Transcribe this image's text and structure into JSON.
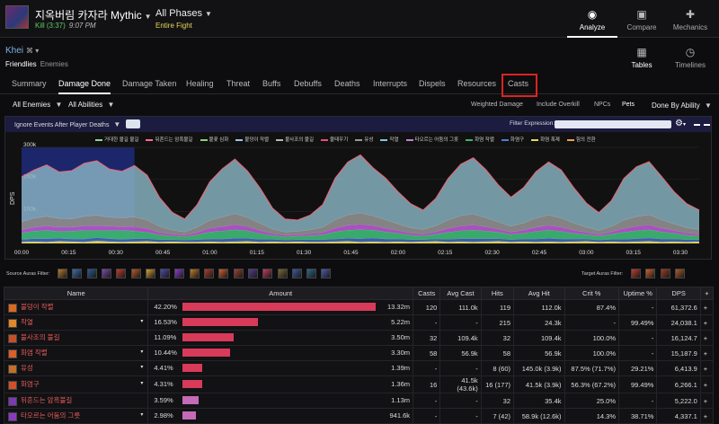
{
  "header": {
    "boss_name": "지옥버림 카자라 Mythic",
    "kill_text": "Kill (3:37)",
    "kill_time": "9:07 PM",
    "phases_label": "All Phases",
    "fight_label": "Entire Fight",
    "nav": [
      {
        "label": "Analyze",
        "icon": "eye-icon"
      },
      {
        "label": "Compare",
        "icon": "compare-icon"
      },
      {
        "label": "Mechanics",
        "icon": "puzzle-icon"
      }
    ]
  },
  "subheader": {
    "player_name": "Khei",
    "player_suffix": "⌘ ▾",
    "friends": "Friendlies",
    "enemies": "Enemies",
    "views": [
      {
        "label": "Tables",
        "icon": "grid-icon"
      },
      {
        "label": "Timelines",
        "icon": "clock-icon"
      }
    ]
  },
  "tabs": [
    "Summary",
    "Damage Done",
    "Damage Taken",
    "Healing",
    "Threat",
    "Buffs",
    "Debuffs",
    "Deaths",
    "Interrupts",
    "Dispels",
    "Resources",
    "Casts"
  ],
  "active_tab": "Damage Done",
  "filters": {
    "enemies": "All Enemies",
    "abilities": "All Abilities",
    "options": [
      "Weighted Damage",
      "Include Overkill",
      "NPCs",
      "Pets"
    ],
    "active_option": "Pets",
    "done_by": "Done By Ability"
  },
  "graph": {
    "ignore_deaths": "Ignore Events After Player Deaths",
    "filter_expression_label": "Filter Expression:",
    "legend": [
      {
        "name": "거대한 불길 불길",
        "color": "#8fd49a"
      },
      {
        "name": "뒤흔드는 암흑불길",
        "color": "#ff6b9d"
      },
      {
        "name": "불꽃 심화",
        "color": "#7fd67f"
      },
      {
        "name": "불덩이 작렬",
        "color": "#a0c4e8"
      },
      {
        "name": "불사조의 불길",
        "color": "#b6b6b6"
      },
      {
        "name": "불태우기",
        "color": "#e84d7a"
      },
      {
        "name": "유성",
        "color": "#999"
      },
      {
        "name": "작열",
        "color": "#7ec8e3"
      },
      {
        "name": "타오르는 어둠의 그릇",
        "color": "#c77dd6"
      },
      {
        "name": "화염 작렬",
        "color": "#3cb371"
      },
      {
        "name": "화염구",
        "color": "#4a7fd6"
      },
      {
        "name": "화염 폭제",
        "color": "#e6d85a"
      },
      {
        "name": "힘의 전환",
        "color": "#f2a24b"
      }
    ]
  },
  "chart_data": {
    "type": "area",
    "ylabel": "DPS",
    "y_ticks": [
      "0k",
      "100k",
      "200k",
      "300k"
    ],
    "ylim": [
      0,
      300000
    ],
    "x_ticks": [
      "00:00",
      "00:15",
      "00:30",
      "00:45",
      "01:00",
      "01:15",
      "01:30",
      "01:45",
      "02:00",
      "02:15",
      "02:30",
      "02:45",
      "03:00",
      "03:15",
      "03:30"
    ],
    "x_seconds": [
      0,
      4,
      8,
      12,
      16,
      20,
      24,
      28,
      32,
      36,
      40,
      44,
      48,
      52,
      56,
      60,
      64,
      68,
      72,
      76,
      80,
      84,
      88,
      92,
      96,
      100,
      104,
      108,
      112,
      116,
      120,
      124,
      128,
      132,
      136,
      140,
      144,
      148,
      152,
      156,
      160,
      164,
      168,
      172,
      176,
      180,
      184,
      188,
      192,
      196,
      200,
      204,
      208,
      212,
      216
    ],
    "series": [
      {
        "name": "화염 폭제",
        "color": "#e6d85a",
        "values": [
          5000,
          6000,
          5000,
          7000,
          6000,
          5000,
          8000,
          6000,
          5000,
          6000,
          7000,
          5000,
          6000,
          5000,
          5000,
          6000,
          5000,
          6000,
          7000,
          5000,
          6000,
          5000,
          6000,
          5000,
          5000,
          6000,
          7000,
          5000,
          6000,
          5000,
          6000,
          5000,
          6000,
          7000,
          5000,
          6000,
          5000,
          6000,
          7000,
          5000,
          6000,
          5000,
          6000,
          5000,
          6000,
          7000,
          5000,
          6000,
          5000,
          6000,
          7000,
          5000,
          6000,
          5000,
          6000
        ]
      },
      {
        "name": "화염구",
        "color": "#3d63b8",
        "values": [
          8000,
          9000,
          10000,
          9000,
          8000,
          9000,
          10000,
          9000,
          8000,
          9000,
          8000,
          7000,
          6000,
          6000,
          7000,
          8000,
          9000,
          10000,
          9000,
          8000,
          7000,
          6000,
          6000,
          7000,
          7000,
          8000,
          9000,
          10000,
          11000,
          9000,
          8000,
          7000,
          6000,
          7000,
          8000,
          9000,
          10000,
          9000,
          8000,
          7000,
          8000,
          9000,
          10000,
          9000,
          8000,
          7000,
          6000,
          7000,
          8000,
          9000,
          10000,
          9000,
          8000,
          7000,
          6000
        ]
      },
      {
        "name": "화염 작렬",
        "color": "#3cb371",
        "values": [
          20000,
          24000,
          26000,
          22000,
          25000,
          27000,
          23000,
          26000,
          28000,
          24000,
          20000,
          15000,
          12000,
          10000,
          15000,
          22000,
          25000,
          27000,
          24000,
          18000,
          12000,
          10000,
          11000,
          13000,
          15000,
          22000,
          26000,
          28000,
          25000,
          22000,
          18000,
          14000,
          12000,
          15000,
          22000,
          25000,
          27000,
          24000,
          20000,
          16000,
          18000,
          24000,
          26000,
          24000,
          18000,
          14000,
          12000,
          16000,
          22000,
          25000,
          26000,
          22000,
          18000,
          14000,
          12000
        ]
      },
      {
        "name": "타오르는 어둠의 그릇",
        "color": "#b155c9",
        "values": [
          10000,
          12000,
          14000,
          13000,
          12000,
          14000,
          15000,
          13000,
          12000,
          14000,
          12000,
          8000,
          6000,
          5000,
          8000,
          12000,
          14000,
          16000,
          13000,
          10000,
          6000,
          5000,
          5000,
          6000,
          8000,
          12000,
          15000,
          17000,
          14000,
          12000,
          9000,
          7000,
          6000,
          8000,
          12000,
          15000,
          16000,
          13000,
          10000,
          8000,
          10000,
          13000,
          15000,
          13000,
          10000,
          7000,
          6000,
          8000,
          12000,
          14000,
          15000,
          12000,
          9000,
          7000,
          6000
        ]
      },
      {
        "name": "불사조의 불길",
        "color": "#8a8a8a",
        "values": [
          25000,
          28000,
          30000,
          27000,
          26000,
          30000,
          32000,
          28000,
          27000,
          30000,
          26000,
          18000,
          12000,
          10000,
          16000,
          24000,
          30000,
          34000,
          28000,
          22000,
          14000,
          10000,
          10000,
          12000,
          16000,
          26000,
          32000,
          36000,
          30000,
          26000,
          20000,
          16000,
          14000,
          18000,
          26000,
          32000,
          34000,
          28000,
          22000,
          18000,
          22000,
          28000,
          32000,
          28000,
          22000,
          16000,
          12000,
          16000,
          26000,
          30000,
          32000,
          26000,
          20000,
          16000,
          14000
        ]
      },
      {
        "name": "작열",
        "color": "#8ab4c4",
        "values": [
          140000,
          150000,
          160000,
          145000,
          150000,
          165000,
          170000,
          150000,
          145000,
          160000,
          140000,
          90000,
          55000,
          40000,
          70000,
          120000,
          150000,
          170000,
          145000,
          110000,
          65000,
          40000,
          35000,
          45000,
          70000,
          130000,
          165000,
          180000,
          150000,
          130000,
          100000,
          75000,
          60000,
          85000,
          130000,
          160000,
          175000,
          150000,
          115000,
          90000,
          110000,
          145000,
          165000,
          150000,
          110000,
          75000,
          55000,
          80000,
          130000,
          155000,
          165000,
          135000,
          100000,
          75000,
          60000
        ]
      }
    ],
    "highlight_range": [
      0,
      36
    ]
  },
  "auras": {
    "source_label": "Source Auras Filter:",
    "target_label": "Target Auras Filter:",
    "source_icons": [
      "#b87a2a",
      "#3a6fb0",
      "#2a5a90",
      "#7a4ab0",
      "#c43a2a",
      "#b85a20",
      "#d8a030",
      "#4a4ab0",
      "#8a3ad0",
      "#c47a20",
      "#b03a2a",
      "#d0602a",
      "#a04030",
      "#5a3a90",
      "#c43a5a",
      "#7a6a30",
      "#3a5aa0",
      "#2a6a8a",
      "#4a5ab0"
    ],
    "target_icons": [
      "#c43a2a",
      "#d0602a",
      "#a03a20",
      "#b05a2a"
    ]
  },
  "table": {
    "headers": [
      "Name",
      "Amount",
      "Casts",
      "Avg Cast",
      "Hits",
      "Avg Hit",
      "Crit %",
      "Uptime %",
      "DPS",
      "+"
    ],
    "rows": [
      {
        "name": "불덩이 작렬",
        "icon": "#d86a20",
        "pct": "42.20%",
        "fill": 0.422,
        "amount": "13.32m",
        "casts": "120",
        "avg_cast": "111.0k",
        "hits": "119",
        "avg_hit": "112.0k",
        "crit": "87.4%",
        "uptime": "-",
        "dps": "61,372.6",
        "expand": ""
      },
      {
        "name": "작열",
        "icon": "#e0882a",
        "pct": "16.53%",
        "fill": 0.1653,
        "amount": "5.22m",
        "casts": "-",
        "avg_cast": "-",
        "hits": "215",
        "avg_hit": "24.3k",
        "crit": "-",
        "uptime": "99.49%",
        "dps": "24,038.1",
        "expand": "▾"
      },
      {
        "name": "불사조의 불길",
        "icon": "#c4502a",
        "pct": "11.09%",
        "fill": 0.1109,
        "amount": "3.50m",
        "casts": "32",
        "avg_cast": "109.4k",
        "hits": "32",
        "avg_hit": "109.4k",
        "crit": "100.0%",
        "uptime": "-",
        "dps": "16,124.7",
        "expand": ""
      },
      {
        "name": "화염 작렬",
        "icon": "#d8602a",
        "pct": "10.44%",
        "fill": 0.1044,
        "amount": "3.30m",
        "casts": "58",
        "avg_cast": "56.9k",
        "hits": "58",
        "avg_hit": "56.9k",
        "crit": "100.0%",
        "uptime": "-",
        "dps": "15,187.9",
        "expand": "▾"
      },
      {
        "name": "유성",
        "icon": "#c0702a",
        "pct": "4.41%",
        "fill": 0.0441,
        "amount": "1.39m",
        "casts": "-",
        "avg_cast": "-",
        "hits": "8 (60)",
        "avg_hit": "145.0k (3.9k)",
        "crit": "87.5% (71.7%)",
        "uptime": "29.21%",
        "dps": "6,413.9",
        "expand": "▾"
      },
      {
        "name": "화염구",
        "icon": "#d0502a",
        "pct": "4.31%",
        "fill": 0.0431,
        "amount": "1.36m",
        "casts": "16",
        "avg_cast": "41.5k (43.6k)",
        "hits": "16 (177)",
        "avg_hit": "41.5k (3.9k)",
        "crit": "56.3% (67.2%)",
        "uptime": "99.49%",
        "dps": "6,266.1",
        "expand": "▾"
      },
      {
        "name": "뒤흔드는 암흑불길",
        "icon": "#7a3ab0",
        "pct": "3.59%",
        "fill": 0.0359,
        "amount": "1.13m",
        "casts": "-",
        "avg_cast": "-",
        "hits": "32",
        "avg_hit": "35.4k",
        "crit": "25.0%",
        "uptime": "-",
        "dps": "5,222.0",
        "expand": ""
      },
      {
        "name": "타오르는 어둠의 그릇",
        "icon": "#8a3ac0",
        "pct": "2.98%",
        "fill": 0.0298,
        "amount": "941.6k",
        "casts": "-",
        "avg_cast": "-",
        "hits": "7 (42)",
        "avg_hit": "58.9k (12.6k)",
        "crit": "14.3%",
        "uptime": "38.71%",
        "dps": "4,337.1",
        "expand": "▾"
      }
    ]
  }
}
